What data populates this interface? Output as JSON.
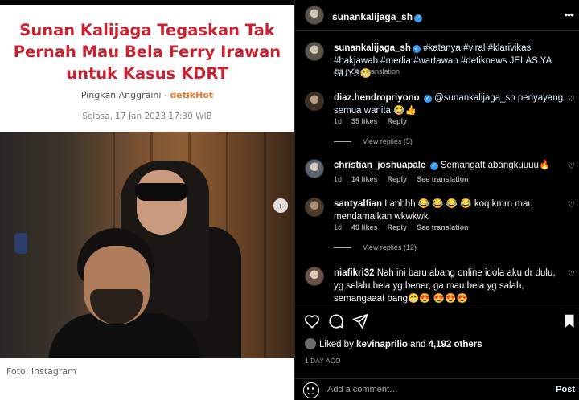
{
  "article": {
    "title": "Sunan Kalijaga Tegaskan Tak Pernah Mau Bela Ferry Irawan untuk Kasus KDRT",
    "author": "Pingkan Anggraini",
    "separator": " - ",
    "source": "detikHot",
    "date": "Selasa, 17 Jan 2023 17:30 WIB",
    "caption": "Foto: Instagram"
  },
  "header": {
    "username": "sunankalijaga_sh"
  },
  "post": {
    "username": "sunankalijaga_sh",
    "caption": "#katanya #viral #klarivikasi #hakjawab #media #wartawan #detiknews JELAS YA GUYS😁",
    "time": "1d",
    "see_translation": "See translation"
  },
  "comments": [
    {
      "username": "diaz.hendropriyono",
      "text": "@sunankalijaga_sh penyayang semua wanita 😂👍",
      "time": "1d",
      "likes": "35 likes",
      "reply": "Reply",
      "view_replies": "View replies (5)"
    },
    {
      "username": "christian_joshuapale",
      "text": "Semangatt abangkuuuu🔥",
      "time": "1d",
      "likes": "14 likes",
      "reply": "Reply",
      "see_translation": "See translation"
    },
    {
      "username": "santyalfian",
      "text": "Lahhhh 😂 😂 😂 😂  koq kmrn mau mendamaikan wkwkwk",
      "time": "1d",
      "likes": "49 likes",
      "reply": "Reply",
      "see_translation": "See translation",
      "view_replies": "View replies (12)"
    },
    {
      "username": "niafikri32",
      "text": "Nah ini baru abang online idola aku dr dulu, yg selalu bela yg bener, ga mau bela yg salah, semangaaat bang😁😍 😍😍😍"
    }
  ],
  "actions": {
    "liked_prefix": "Liked by",
    "liked_user": "kevinaprilio",
    "liked_and": "and",
    "liked_count": "4,192 others",
    "time_ago": "1 DAY AGO",
    "add_comment_placeholder": "Add a comment…",
    "post_label": "Post"
  },
  "icons": [
    "verified-icon",
    "more-icon",
    "heart-icon",
    "comment-icon",
    "share-icon",
    "bookmark-icon",
    "emoji-icon",
    "chevron-right-icon"
  ],
  "colors": {
    "accent": "#3897f0",
    "title_red": "#c8212f",
    "source_orange": "#e07a2e"
  }
}
